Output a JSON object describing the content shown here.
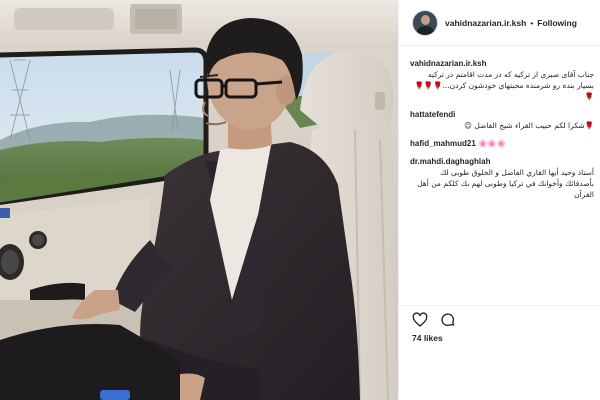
{
  "post": {
    "photo": {
      "subject": "man in a dark suit and glasses sitting in the back seat of a car, looking out the window"
    },
    "header": {
      "username": "vahidnazarian.ir.ksh",
      "separator": "•",
      "follow_label": "Following"
    },
    "comments": [
      {
        "username": "vahidnazarian.ir.ksh",
        "text": "جناب آقای صبری از ترکیه که در مدت اقامتم در ترکیه بسیار بنده رو شرمنده محبتهای خودشون کردن...🌹🌹🌹🌹"
      },
      {
        "username": "hattatefendi",
        "text": "🌹شكرا لكم حبيب القراء شيخ الفاضل 😊"
      },
      {
        "username": "hafid_mahmud21",
        "text": "🌸🌸🌸"
      },
      {
        "username": "dr.mahdi.daghaghlah",
        "text": "أستاذ وحيد أيها القاري الفاضل و الخلوق طوبى لك بأصدقائك وأخوانك في تركيا وطوبى لهم بك كلكم من أهل القرآن"
      }
    ],
    "actions": {
      "like_icon": "heart-icon",
      "comment_icon": "comment-icon"
    },
    "likes_text": "74 likes",
    "colors": {
      "text": "#262626",
      "border": "#efefef",
      "background": "#ffffff"
    }
  }
}
